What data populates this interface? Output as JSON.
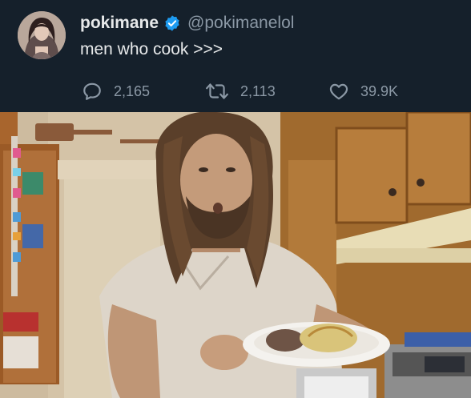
{
  "tweet": {
    "author": {
      "display_name": "pokimane",
      "handle": "@pokimanelol",
      "verified": true,
      "verified_icon": "verified-badge-icon",
      "verified_color": "#1d9bf0"
    },
    "text": "men who cook >>>",
    "actions": {
      "replies": {
        "icon": "reply-icon",
        "count": "2,165"
      },
      "retweets": {
        "icon": "retweet-icon",
        "count": "2,113"
      },
      "likes": {
        "icon": "heart-icon",
        "count": "39.9K"
      }
    },
    "media": {
      "type": "photo",
      "icon": "kitchen-photo"
    }
  },
  "theme": {
    "background": "#15202b",
    "text": "#e7e9ea",
    "secondary_text": "#8b98a5",
    "accent": "#1d9bf0"
  }
}
